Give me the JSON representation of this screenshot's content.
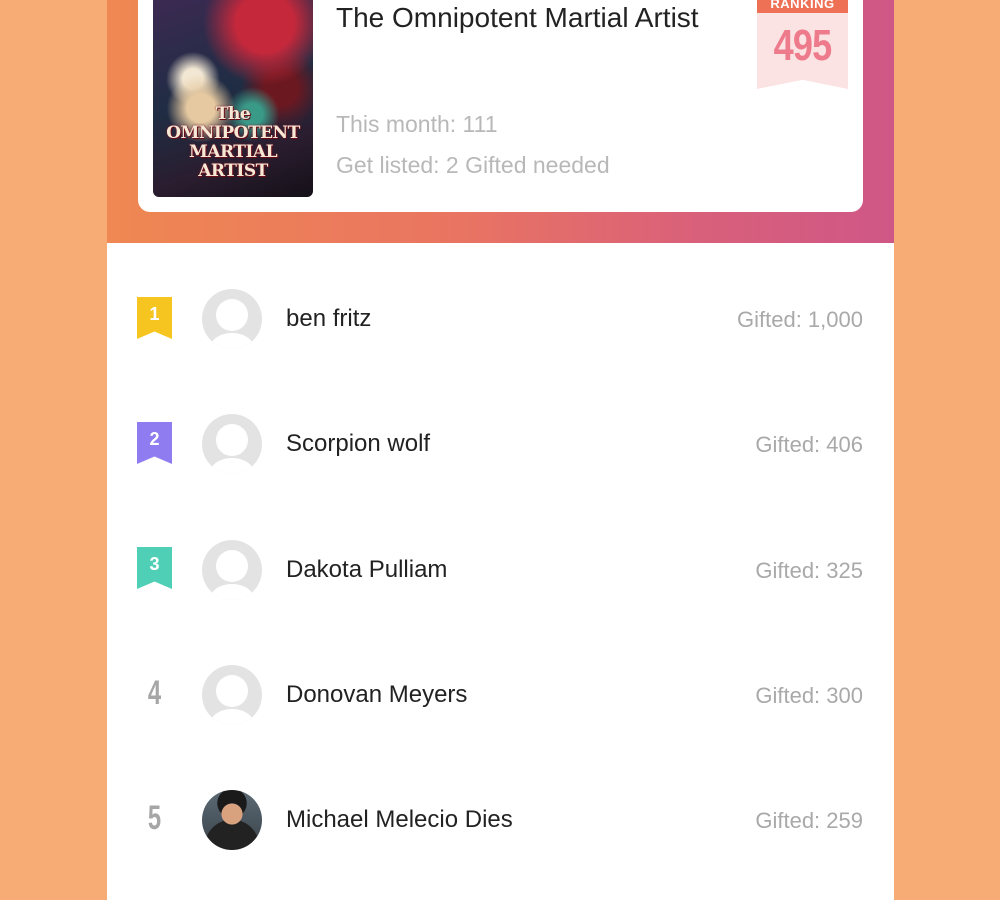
{
  "book": {
    "title": "The Omnipotent Martial Artist",
    "cover_text": "The OMNIPOTENT MARTIAL ARTIST",
    "this_month": "This month: 111",
    "get_listed": "Get listed: 2 Gifted needed"
  },
  "ranking": {
    "label": "RANKING",
    "value": "495"
  },
  "leaderboard": [
    {
      "rank": "1",
      "name": "ben fritz",
      "gifted": "Gifted: 1,000",
      "ribbon_color": "#f7c520",
      "avatar": "default"
    },
    {
      "rank": "2",
      "name": "Scorpion wolf",
      "gifted": "Gifted: 406",
      "ribbon_color": "#8f7cf0",
      "avatar": "default"
    },
    {
      "rank": "3",
      "name": "Dakota Pulliam",
      "gifted": "Gifted: 325",
      "ribbon_color": "#4fcfb6",
      "avatar": "default"
    },
    {
      "rank": "4",
      "name": "Donovan Meyers",
      "gifted": "Gifted: 300",
      "avatar": "default"
    },
    {
      "rank": "5",
      "name": "Michael Melecio Dies",
      "gifted": "Gifted: 259",
      "avatar": "photo"
    }
  ]
}
